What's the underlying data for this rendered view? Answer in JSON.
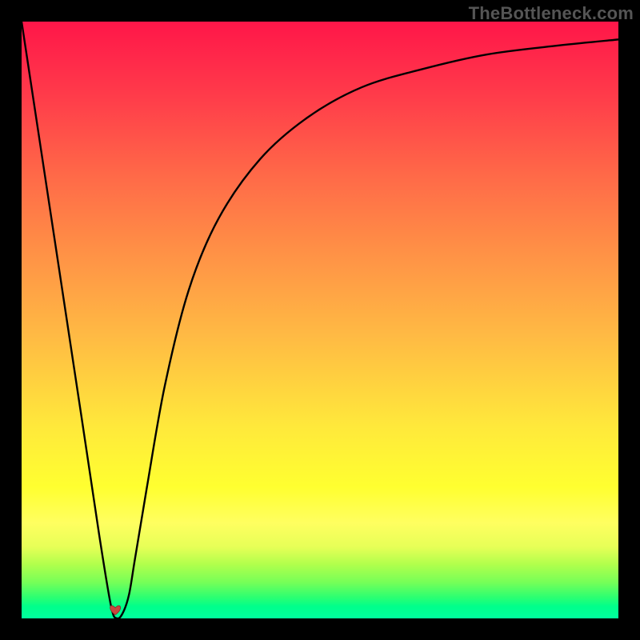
{
  "watermark": "TheBottleneck.com",
  "chart_data": {
    "type": "line",
    "title": "",
    "xlabel": "",
    "ylabel": "",
    "xlim": [
      0,
      100
    ],
    "ylim": [
      0,
      100
    ],
    "grid": false,
    "series": [
      {
        "name": "bottleneck-curve",
        "x": [
          0,
          5,
          10,
          13,
          15,
          16,
          17,
          18,
          19,
          21,
          24,
          28,
          33,
          40,
          48,
          57,
          67,
          78,
          90,
          100
        ],
        "values": [
          100,
          67,
          34,
          14,
          2,
          0,
          1,
          4,
          10,
          22,
          39,
          55,
          67,
          77,
          84,
          89,
          92,
          94.5,
          96,
          97
        ]
      }
    ],
    "markers": [
      {
        "name": "optimal-point-heart",
        "x": 15.7,
        "y": 1.4,
        "color": "#c9463e"
      }
    ],
    "background_gradient": {
      "stops": [
        {
          "pos": 0.0,
          "color": "#ff1649"
        },
        {
          "pos": 0.12,
          "color": "#ff3a4a"
        },
        {
          "pos": 0.26,
          "color": "#ff6a48"
        },
        {
          "pos": 0.38,
          "color": "#ff8f46"
        },
        {
          "pos": 0.52,
          "color": "#ffb844"
        },
        {
          "pos": 0.68,
          "color": "#ffe93b"
        },
        {
          "pos": 0.78,
          "color": "#ffff30"
        },
        {
          "pos": 0.84,
          "color": "#ffff60"
        },
        {
          "pos": 0.88,
          "color": "#e7ff57"
        },
        {
          "pos": 0.91,
          "color": "#b0ff4c"
        },
        {
          "pos": 0.94,
          "color": "#75ff58"
        },
        {
          "pos": 0.965,
          "color": "#2bff72"
        },
        {
          "pos": 0.98,
          "color": "#00ff8b"
        },
        {
          "pos": 1.0,
          "color": "#00ff9e"
        }
      ]
    }
  }
}
